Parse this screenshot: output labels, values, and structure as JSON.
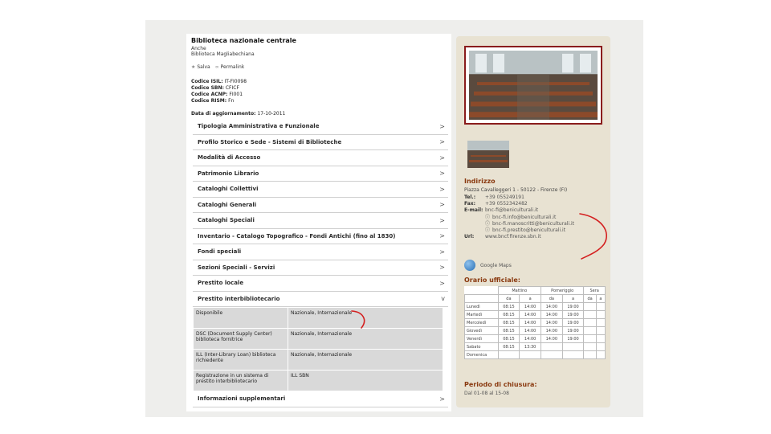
{
  "header": {
    "title": "Biblioteca nazionale centrale",
    "also_label": "Anche",
    "alt_name": "Biblioteca Magliabechiana",
    "save_label": "Salva",
    "permalink_label": "Permalink"
  },
  "codes": [
    {
      "key": "Codice ISIL:",
      "value": "IT-FI0098"
    },
    {
      "key": "Codice SBN:",
      "value": "CFICF"
    },
    {
      "key": "Codice ACNP:",
      "value": "FI001"
    },
    {
      "key": "Codice RISM:",
      "value": "Fn"
    }
  ],
  "update": {
    "label": "Data di aggiornamento:",
    "value": "17-10-2011"
  },
  "sections_top": [
    "Tipologia Amministrativa e Funzionale",
    "Profilo Storico e Sede - Sistemi di Biblioteche",
    "Modalità di Accesso",
    "Patrimonio Librario",
    "Cataloghi Collettivi",
    "Cataloghi Generali",
    "Cataloghi Speciali",
    "Inventario - Catalogo Topografico - Fondi Antichi (fino al 1830)",
    "Fondi speciali",
    "Sezioni Speciali - Servizi",
    "Prestito locale"
  ],
  "section_open": {
    "label": "Prestito interbibliotecario",
    "arrow": "v"
  },
  "loan_table": [
    {
      "key": "Disponibile",
      "value": "Nazionale, Internazionale"
    },
    {
      "key": "DSC (Document Supply Center) biblioteca fornitrice",
      "value": "Nazionale, Internazionale"
    },
    {
      "key": "ILL (Inter-Library Loan) biblioteca richiedente",
      "value": "Nazionale, Internazionale"
    },
    {
      "key": "Registrazione in un sistema di prestito interbibliotecario",
      "value": "ILL SBN"
    }
  ],
  "section_last": "Informazioni supplementari",
  "arrow_glyph": ">",
  "sidebar": {
    "address_title": "Indirizzo",
    "address": "Piazza Cavalleggeri 1 - 50122 - Firenze (FI)",
    "contacts": [
      {
        "key": "Tel.:",
        "value": "+39 055249191",
        "icon": ""
      },
      {
        "key": "Fax:",
        "value": "+39 0552342482",
        "icon": ""
      },
      {
        "key": "E-mail:",
        "value": "bnc-fi@beniculturali.it",
        "icon": ""
      },
      {
        "key": "",
        "value": "bnc-fi.info@beniculturali.it",
        "icon": "info-icon"
      },
      {
        "key": "",
        "value": "bnc-fi.manoscritti@beniculturali.it",
        "icon": "info-icon"
      },
      {
        "key": "",
        "value": "bnc-fi.prestito@beniculturali.it",
        "icon": "info-icon"
      },
      {
        "key": "Url:",
        "value": "www.bncf.firenze.sbn.it",
        "icon": ""
      }
    ],
    "maps_label": "Google Maps",
    "hours_title": "Orario ufficiale:",
    "hours": {
      "groups": [
        "Mattino",
        "Pomeriggio",
        "Sera"
      ],
      "subheads": [
        "da",
        "a",
        "da",
        "a",
        "da",
        "a"
      ],
      "rows": [
        [
          "Lunedì",
          "08:15",
          "14:00",
          "14:00",
          "19:00",
          "",
          ""
        ],
        [
          "Martedì",
          "08:15",
          "14:00",
          "14:00",
          "19:00",
          "",
          ""
        ],
        [
          "Mercoledì",
          "08:15",
          "14:00",
          "14:00",
          "19:00",
          "",
          ""
        ],
        [
          "Giovedì",
          "08:15",
          "14:00",
          "14:00",
          "19:00",
          "",
          ""
        ],
        [
          "Venerdì",
          "08:15",
          "14:00",
          "14:00",
          "19:00",
          "",
          ""
        ],
        [
          "Sabato",
          "08:15",
          "13:30",
          "",
          "",
          "",
          ""
        ],
        [
          "Domenica",
          "",
          "",
          "",
          "",
          "",
          ""
        ]
      ]
    },
    "closing_title": "Periodo di chiusura:",
    "closing_value": "Dal 01-08 al 15-08"
  },
  "colors": {
    "accent": "#8a3a10",
    "frame": "#8a1c1c",
    "annotation": "#d42020",
    "sidebar_bg": "#e8e2d2"
  }
}
